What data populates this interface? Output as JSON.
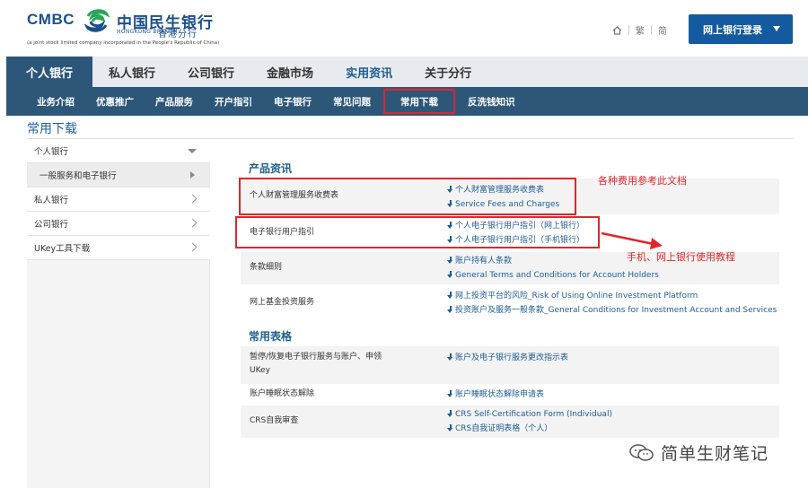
{
  "header": {
    "logo_text": "CMBC",
    "logo_cn": "中国民生银行",
    "logo_branch_en": "HONGKONG BRANCH",
    "logo_branch_cn": "香港分行",
    "logo_sub": "(a joint stock limited company incorporated in the People's Republic of China)",
    "tools": {
      "home_icon": "home-icon",
      "trad": "繁",
      "simp": "简"
    },
    "login_label": "网上银行登录"
  },
  "mainnav": [
    "个人银行",
    "私人银行",
    "公司银行",
    "金融市场",
    "实用资讯",
    "关于分行"
  ],
  "subnav": [
    "业务介绍",
    "优惠推广",
    "产品服务",
    "开户指引",
    "电子银行",
    "常见问题",
    "常用下载",
    "反洗钱知识"
  ],
  "page_title": "常用下载",
  "sidebar": {
    "items": [
      "个人银行",
      "一般服务和电子银行",
      "私人银行",
      "公司银行",
      "UKey工具下载"
    ]
  },
  "content": {
    "section1": "产品资讯",
    "rows1": [
      {
        "label": "个人财富管理服务收费表",
        "links": [
          "个人财富管理服务收费表",
          "Service Fees and Charges"
        ]
      },
      {
        "label": "电子银行用户指引",
        "links": [
          "个人电子银行用户指引（网上银行）",
          "个人电子银行用户指引（手机银行）"
        ]
      },
      {
        "label": "条款细则",
        "links": [
          "账户持有人条款",
          "General Terms and Conditions for Account Holders"
        ]
      },
      {
        "label": "网上基金投资服务",
        "links": [
          "网上投资平台的风险_Risk of Using Online Investment Platform",
          "投资账户及服务一般条款_General Conditions for Investment Account and Services"
        ]
      }
    ],
    "section2": "常用表格",
    "rows2": [
      {
        "label": "暂停/恢复电子银行服务与账户、申领UKey",
        "links": [
          "账户及电子银行服务更改指示表"
        ]
      },
      {
        "label": "账户睡眠状态解除",
        "links": [
          "账户睡眠状态解除申请表"
        ]
      },
      {
        "label": "CRS自我审查",
        "links": [
          "CRS Self-Certification Form (Individual)",
          "CRS自我证明表格（个人）"
        ]
      }
    ]
  },
  "annotations": {
    "note1": "各种费用参考此文档",
    "note2": "手机、网上银行使用教程"
  },
  "watermark": "简单生财笔记",
  "colors": {
    "brand": "#1b4f8c",
    "nav_dark": "#2d5779",
    "annotation": "#e0262c"
  }
}
